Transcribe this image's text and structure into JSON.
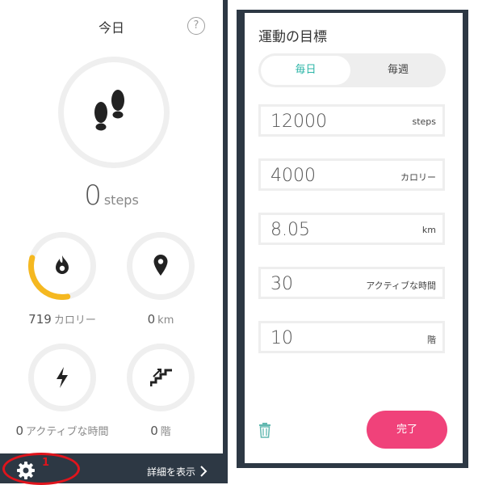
{
  "colors": {
    "accent_teal": "#2bb5a7",
    "done_pink": "#f0427a",
    "calorie_progress_yellow": "#f5b820",
    "dark_frame": "#2d3844",
    "annotation_red": "#e0141c"
  },
  "today": {
    "title": "今日",
    "help_label": "?",
    "help_icon": "question-circle-icon",
    "steps": {
      "value": "0",
      "unit": "steps",
      "icon": "footprints-icon"
    },
    "stats": [
      {
        "value": "719",
        "unit": "カロリー",
        "icon": "flame-icon",
        "progress": 0.32
      },
      {
        "value": "0",
        "unit": "km",
        "icon": "map-pin-icon",
        "progress": 0
      },
      {
        "value": "0",
        "unit": "アクティブな時間",
        "icon": "lightning-icon",
        "progress": 0
      },
      {
        "value": "0",
        "unit": "階",
        "icon": "stairs-icon",
        "progress": 0
      }
    ],
    "footer": {
      "gear_icon": "gear-icon",
      "details_label": "詳細を表示",
      "chevron_icon": "chevron-right-icon"
    },
    "annotation": {
      "label": "1"
    }
  },
  "goals": {
    "title": "運動の目標",
    "tabs": [
      {
        "label": "毎日",
        "selected": true
      },
      {
        "label": "毎週",
        "selected": false
      }
    ],
    "fields": [
      {
        "value": "12000",
        "unit": "steps"
      },
      {
        "value": "4000",
        "unit": "カロリー"
      },
      {
        "value": "8.05",
        "unit": "km"
      },
      {
        "value": "30",
        "unit": "アクティブな時間"
      },
      {
        "value": "10",
        "unit": "階"
      }
    ],
    "delete_icon": "trash-icon",
    "done_label": "完了"
  }
}
